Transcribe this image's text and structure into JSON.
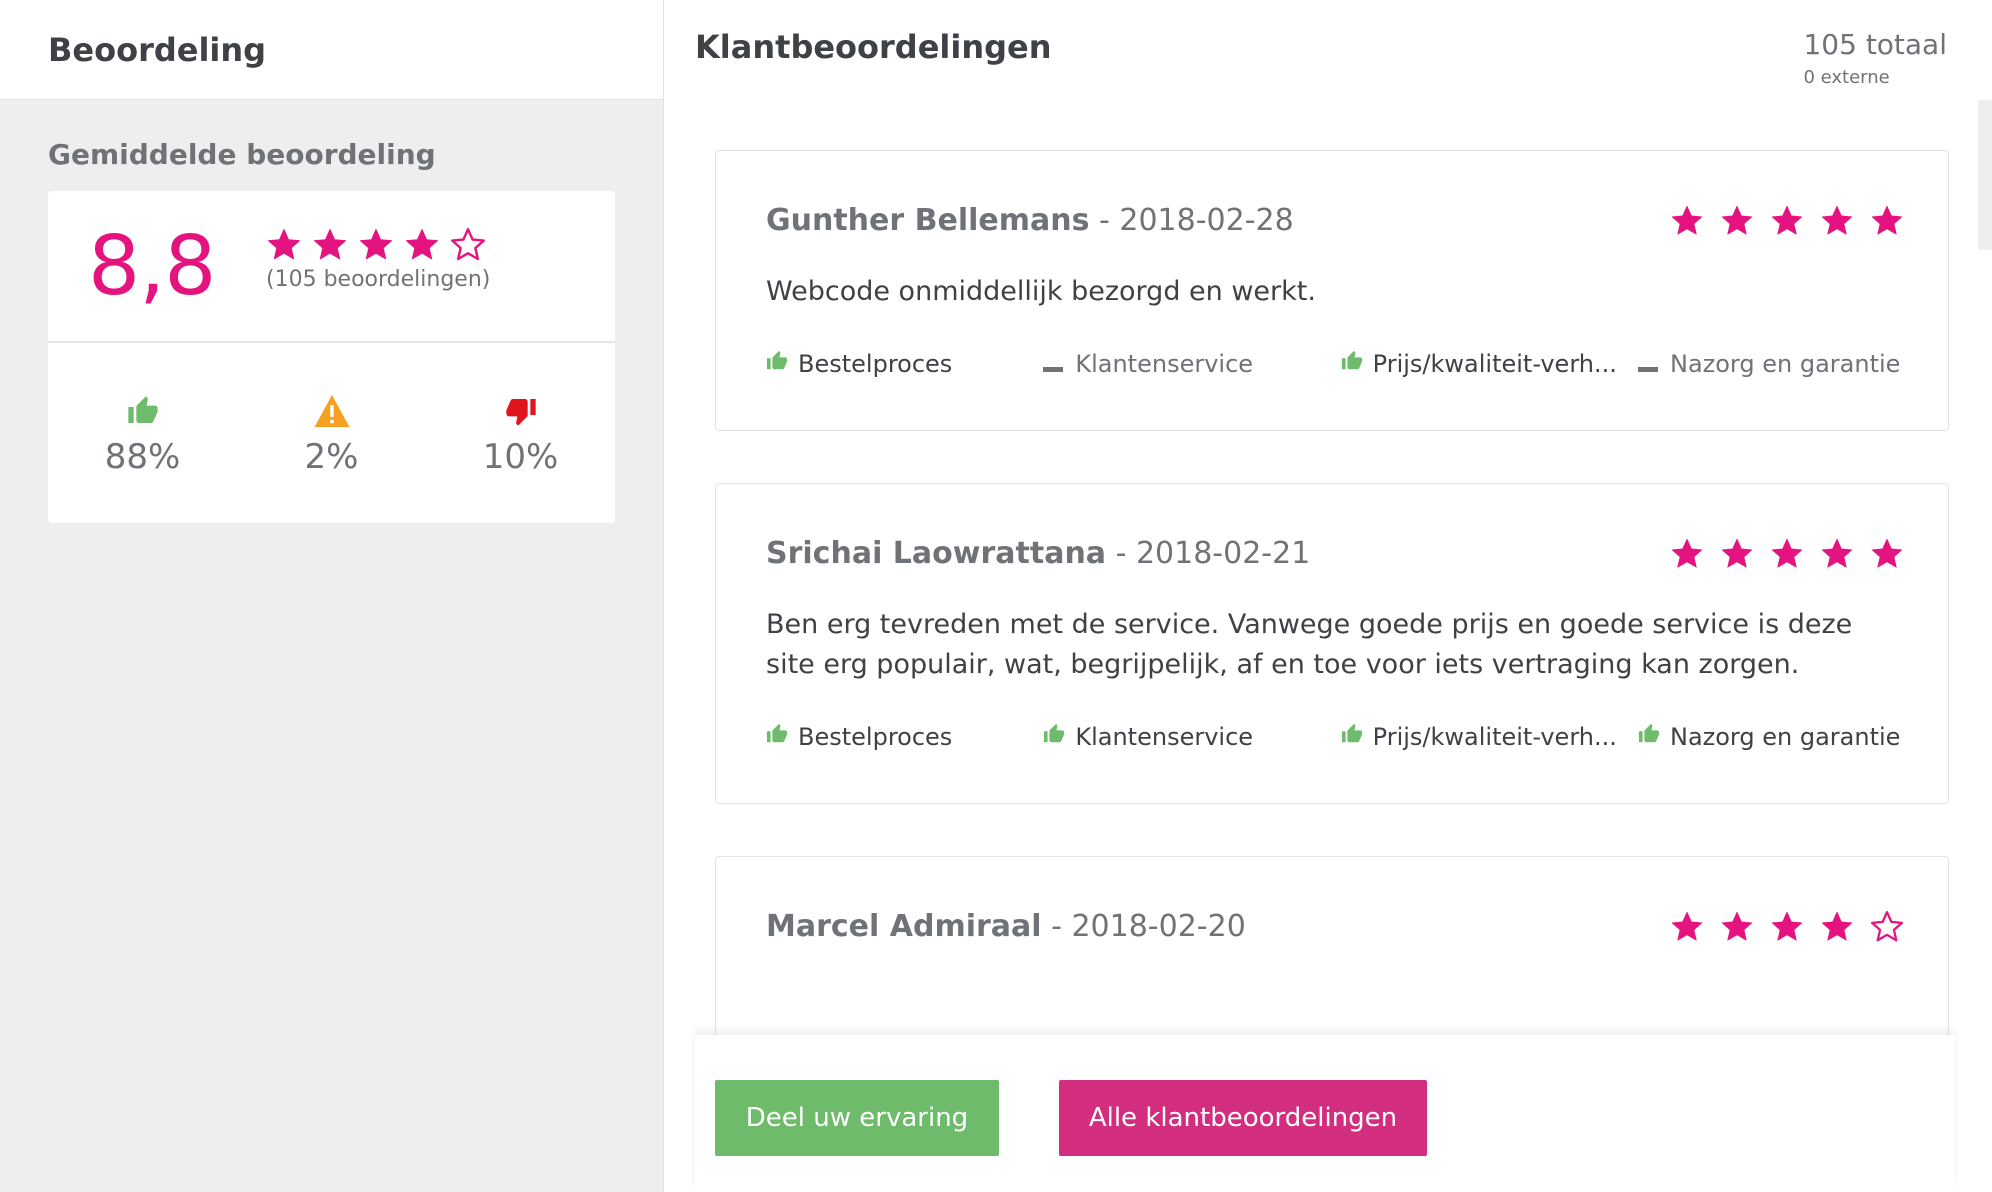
{
  "colors": {
    "accent_pink": "#e5137f",
    "button_green": "#6dbb6b",
    "button_pink": "#d22d7f",
    "positive_green": "#6dbb6b",
    "warning_orange": "#f4a020",
    "negative_red": "#e0141d"
  },
  "left": {
    "title": "Beoordeling",
    "avg_title": "Gemiddelde beoordeling",
    "score": "8,8",
    "rating_stars": 4,
    "rating_count": "(105 beoordelingen)",
    "stats": {
      "positive": {
        "icon": "thumbs-up-icon",
        "value": "88%"
      },
      "neutral": {
        "icon": "warning-icon",
        "value": "2%"
      },
      "negative": {
        "icon": "thumbs-down-icon",
        "value": "10%"
      }
    }
  },
  "right": {
    "title": "Klantbeoordelingen",
    "total": "105 totaal",
    "external": "0 externe"
  },
  "reviews": [
    {
      "name": "Gunther Bellemans",
      "date": " - 2018-02-28",
      "stars": 5,
      "text": "Webcode onmiddellijk bezorgd en werkt.",
      "aspects": [
        {
          "label": "Bestelproces",
          "state": "positive"
        },
        {
          "label": "Klantenservice",
          "state": "neutral"
        },
        {
          "label": "Prijs/kwaliteit-verh...",
          "state": "positive"
        },
        {
          "label": "Nazorg en garantie",
          "state": "neutral"
        }
      ]
    },
    {
      "name": "Srichai Laowrattana",
      "date": " - 2018-02-21",
      "stars": 5,
      "text": "Ben erg tevreden met de service. Vanwege goede prijs en goede service is deze site erg populair, wat, begrijpelijk, af en toe voor iets vertraging kan zorgen.",
      "aspects": [
        {
          "label": "Bestelproces",
          "state": "positive"
        },
        {
          "label": "Klantenservice",
          "state": "positive"
        },
        {
          "label": "Prijs/kwaliteit-verh...",
          "state": "positive"
        },
        {
          "label": "Nazorg en garantie",
          "state": "positive"
        }
      ]
    },
    {
      "name": "Marcel Admiraal",
      "date": " - 2018-02-20",
      "stars": 4
    }
  ],
  "buttons": {
    "share": "Deel uw ervaring",
    "all_reviews": "Alle klantbeoordelingen"
  }
}
